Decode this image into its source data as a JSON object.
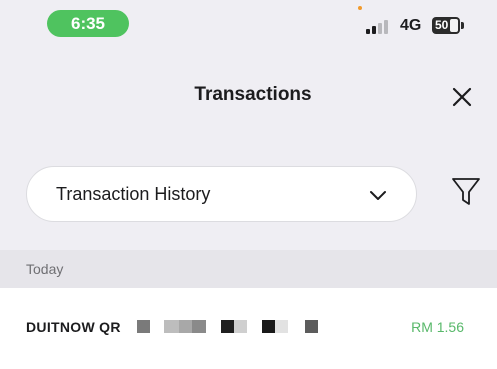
{
  "status_bar": {
    "time": "6:35",
    "network": "4G",
    "battery_level": "50",
    "pill_color": "#4fc35f"
  },
  "header": {
    "title": "Transactions",
    "close_icon": "close-icon"
  },
  "filter_bar": {
    "selected_option": "Transaction History",
    "chevron_icon": "chevron-down-icon",
    "filter_icon": "filter-icon"
  },
  "sections": [
    {
      "label": "Today",
      "transactions": [
        {
          "name": "DUITNOW QR",
          "reference": "obscured",
          "amount": "RM 1.56"
        }
      ]
    }
  ],
  "colors": {
    "accent_green": "#58b86a",
    "background": "#efeef3"
  }
}
